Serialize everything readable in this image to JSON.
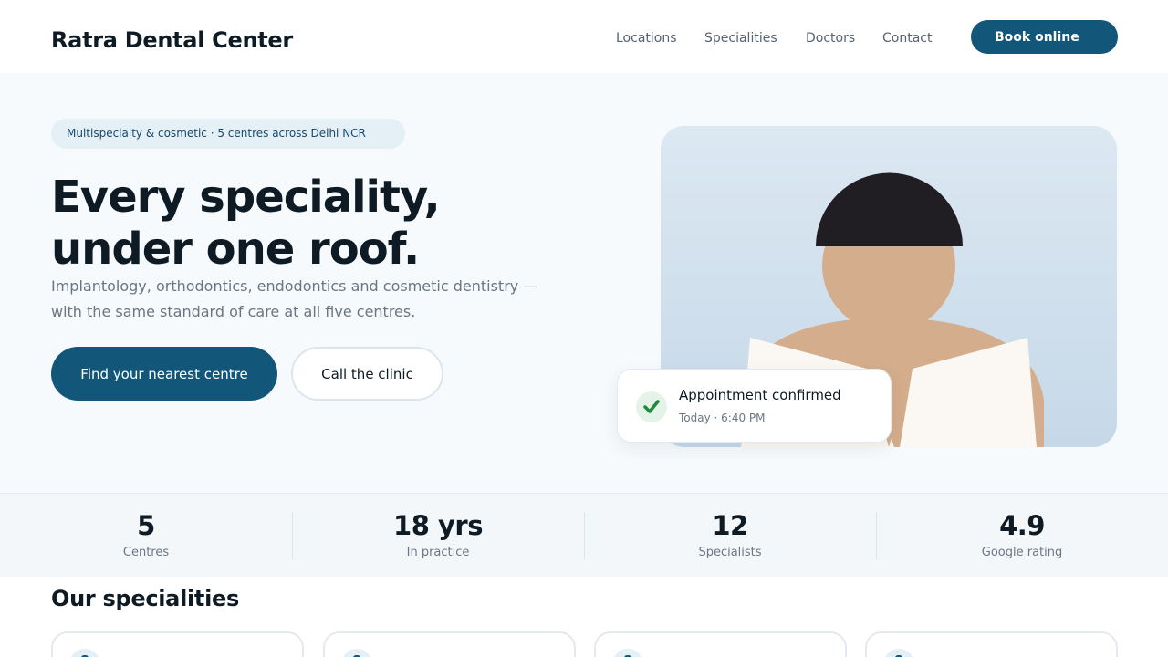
{
  "header": {
    "brand": "Ratra Dental Center",
    "nav": [
      "Locations",
      "Specialities",
      "Doctors",
      "Contact"
    ],
    "cta": "Book online"
  },
  "hero": {
    "pill": "Multispecialty & cosmetic · 5 centres across Delhi NCR",
    "title_line1": "Every speciality,",
    "title_line2": "under one roof.",
    "subtitle": "Implantology, orthodontics, endodontics and cosmetic dentistry — with the same standard of care at all five centres.",
    "primary_cta": "Find your nearest centre",
    "secondary_cta": "Call the clinic",
    "card": {
      "title": "Appointment confirmed",
      "time": "Today · 6:40 PM",
      "icon": "check-icon"
    }
  },
  "stats": [
    {
      "value": "5",
      "label": "Centres"
    },
    {
      "value": "18 yrs",
      "label": "In practice"
    },
    {
      "value": "12",
      "label": "Specialists"
    },
    {
      "value": "4.9",
      "label": "Google rating"
    }
  ],
  "specialities": {
    "title": "Our specialities",
    "card_icon": "tooth-icon"
  },
  "colors": {
    "primary": "#12567a",
    "text": "#0f1b24",
    "muted": "#6a7683",
    "success": "#1f8a3b",
    "hero_bg": "#f7fafc"
  }
}
